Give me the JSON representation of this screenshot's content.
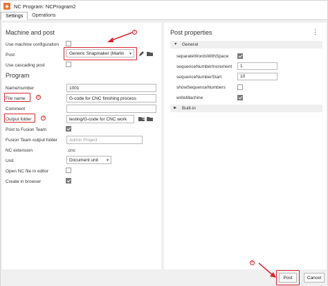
{
  "window": {
    "title": "NC Program: NCProgram2"
  },
  "tabs": [
    {
      "label": "Settings"
    },
    {
      "label": "Operations"
    }
  ],
  "left": {
    "machine_heading": "Machine and post",
    "use_machine_label": "Use machine configuration",
    "use_machine_checked": false,
    "post_label": "Post",
    "post_value": "Generic Snapmaker (Marlin",
    "use_cascading_label": "Use cascading post",
    "use_cascading_checked": false,
    "program_heading": "Program",
    "name_number_label": "Name/number",
    "name_number_value": "1001",
    "file_name_label": "File name",
    "file_name_value": "G-code for CNC finishing process",
    "comment_label": "Comment",
    "comment_value": "",
    "output_folder_label": "Output folder",
    "output_folder_value": "testing/G-code for CNC work",
    "post_to_team_label": "Post to Fusion Team",
    "post_to_team_checked": true,
    "team_output_label": "Fusion Team output folder",
    "team_output_placeholder": "Admin Project",
    "nc_extension_label": "NC extension",
    "nc_extension_value": ".cnc",
    "unit_label": "Unit",
    "unit_value": "Document unit",
    "open_nc_label": "Open NC file in editor",
    "open_nc_checked": false,
    "create_browser_label": "Create in browser",
    "create_browser_checked": true
  },
  "right": {
    "heading": "Post properties",
    "menu_glyph": "⋮",
    "general_group": "General",
    "builtin_group": "Built-in",
    "props": [
      {
        "label": "separateWordsWithSpace",
        "type": "checkbox",
        "checked": true
      },
      {
        "label": "sequenceNumberIncrement",
        "type": "input",
        "value": "1"
      },
      {
        "label": "sequenceNumberStart",
        "type": "input",
        "value": "10"
      },
      {
        "label": "showSequenceNumbers",
        "type": "checkbox",
        "checked": false
      },
      {
        "label": "writeMachine",
        "type": "checkbox",
        "checked": true
      }
    ]
  },
  "annotations": {
    "n1": "①",
    "n2": "②",
    "n3": "③",
    "n4": "④"
  },
  "buttons": {
    "post": "Post",
    "cancel": "Cancel"
  },
  "colors": {
    "annotation_red": "#d9232b",
    "checkbox_on": "#7a7a7a"
  }
}
